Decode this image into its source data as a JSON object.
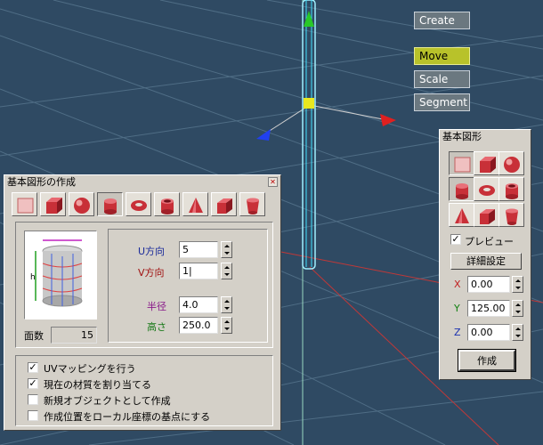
{
  "toolbar": {
    "create": "Create",
    "move": "Move",
    "scale": "Scale",
    "segment": "Segment"
  },
  "dialog": {
    "title": "基本図形の作成",
    "close_glyph": "✕",
    "face_count_label": "面数",
    "face_count_value": "15",
    "u_label": "U方向",
    "u_value": "5",
    "v_label": "V方向",
    "v_value": "1|",
    "radius_label": "半径",
    "radius_value": "4.0",
    "height_label": "高さ",
    "height_value": "250.0",
    "preview_h_label": "h",
    "checks": [
      {
        "label": "UVマッピングを行う",
        "checked": true
      },
      {
        "label": "現在の材質を割り当てる",
        "checked": true
      },
      {
        "label": "新規オブジェクトとして作成",
        "checked": false
      },
      {
        "label": "作成位置をローカル座標の基点にする",
        "checked": false
      }
    ]
  },
  "panel": {
    "title": "基本図形",
    "preview_label": "プレビュー",
    "preview_checked": true,
    "detail_button": "詳細設定",
    "x_label": "X",
    "x_value": "0.00",
    "y_label": "Y",
    "y_value": "125.00",
    "z_label": "Z",
    "z_value": "0.00",
    "create_button": "作成"
  },
  "colors": {
    "viewport": "#2f4a63",
    "accent_move": "#b8c22a",
    "shape_red": "#c8343c"
  }
}
